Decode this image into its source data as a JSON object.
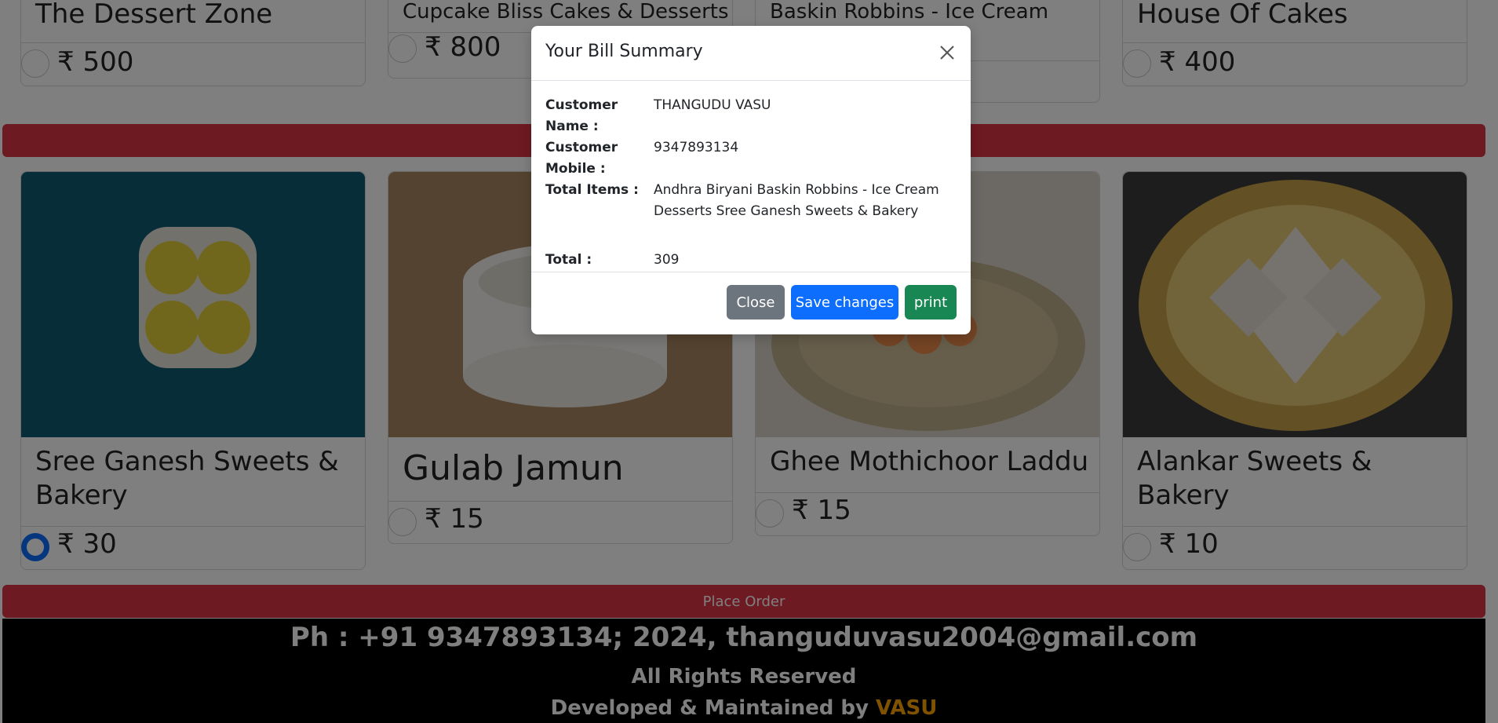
{
  "top_cards": [
    {
      "title": "The Dessert Zone",
      "price": "₹ 500"
    },
    {
      "title": "Cupcake Bliss Cakes & Desserts",
      "price": "₹ 800"
    },
    {
      "title": "Baskin Robbins - Ice Cream",
      "price": ""
    },
    {
      "title": "House Of Cakes",
      "price": "₹ 400"
    }
  ],
  "cards": [
    {
      "title": "Sree Ganesh Sweets & Bakery",
      "price": "₹ 30",
      "selected": true
    },
    {
      "title": "Gulab Jamun",
      "price": "₹ 15",
      "selected": false
    },
    {
      "title": "Ghee Mothichoor Laddu",
      "price": "₹ 15",
      "selected": false
    },
    {
      "title": "Alankar Sweets & Bakery",
      "price": "₹ 10",
      "selected": false
    }
  ],
  "place_order_label": "Place Order",
  "footer": {
    "contact": "Ph : +91 9347893134; 2024, thanguduvasu2004@gmail.com",
    "rights": "All Rights Reserved",
    "developed_prefix": "Developed & Maintained by",
    "developer": "VASU"
  },
  "modal": {
    "title": "Your Bill Summary",
    "rows": [
      {
        "label": "Customer Name :",
        "value": "THANGUDU VASU"
      },
      {
        "label": "Customer Mobile :",
        "value": "9347893134"
      },
      {
        "label": "Total Items :",
        "value": "Andhra Biryani Baskin Robbins - Ice Cream Desserts Sree Ganesh Sweets & Bakery"
      },
      {
        "label": "Total :",
        "value": "309"
      }
    ],
    "buttons": {
      "close": "Close",
      "save": "Save changes",
      "print": "print"
    }
  },
  "colors": {
    "brand_red": "#dc3545",
    "primary": "#0d6efd",
    "secondary": "#6c757d",
    "success": "#198754",
    "developer_name": "#ffa500"
  }
}
